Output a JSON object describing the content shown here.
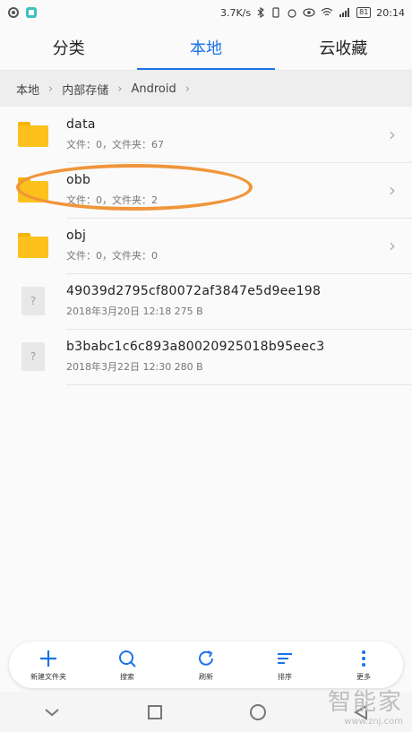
{
  "status": {
    "speed": "3.7K/s",
    "battery": "81",
    "time": "20:14"
  },
  "tabs": [
    {
      "label": "分类"
    },
    {
      "label": "本地"
    },
    {
      "label": "云收藏"
    }
  ],
  "breadcrumb": [
    "本地",
    "内部存储",
    "Android"
  ],
  "items": [
    {
      "name": "data",
      "meta": "文件：0，文件夹：67",
      "type": "folder"
    },
    {
      "name": "obb",
      "meta": "文件：0，文件夹：2",
      "type": "folder"
    },
    {
      "name": "obj",
      "meta": "文件：0，文件夹：0",
      "type": "folder"
    },
    {
      "name": "49039d2795cf80072af3847e5d9ee198",
      "meta": "2018年3月20日 12:18 275 B",
      "type": "file"
    },
    {
      "name": "b3babc1c6c893a80020925018b95eec3",
      "meta": "2018年3月22日 12:30 280 B",
      "type": "file"
    }
  ],
  "toolbar": [
    {
      "label": "新建文件夹",
      "icon": "plus-icon"
    },
    {
      "label": "搜索",
      "icon": "search-icon"
    },
    {
      "label": "刷新",
      "icon": "refresh-icon"
    },
    {
      "label": "排序",
      "icon": "sort-icon"
    },
    {
      "label": "更多",
      "icon": "more-icon"
    }
  ],
  "watermark": {
    "big": "智能家",
    "small": "www.znj.com"
  },
  "colors": {
    "accent": "#1a73e8",
    "folder": "#fcc11c",
    "annotation": "#f0953a"
  }
}
